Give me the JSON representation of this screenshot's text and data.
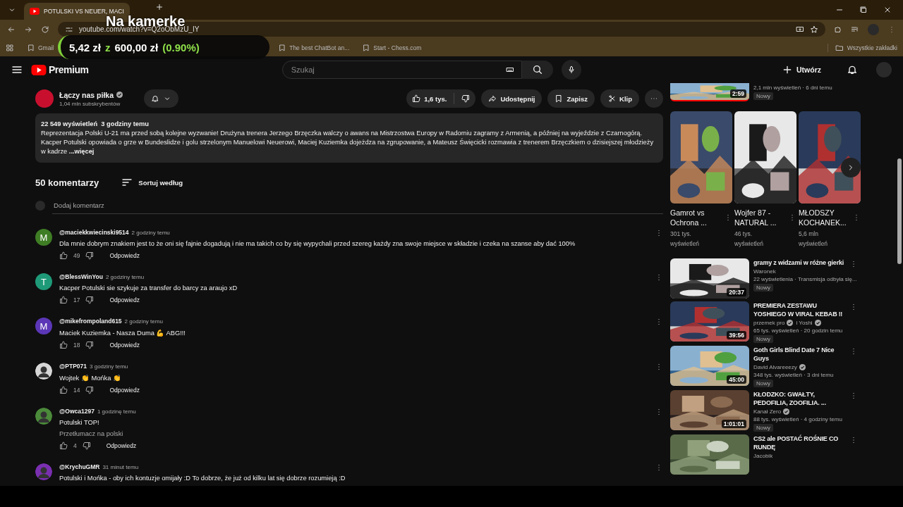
{
  "browser": {
    "tabs": [
      {
        "title": "POTULSKI VS NEUER, MACI",
        "selected": true
      }
    ],
    "url": "youtube.com/watch?v=Q2oObMzU_IY",
    "bookmarks": [
      {
        "label": "Gmail"
      },
      {
        "label": "The best ChatBot an..."
      },
      {
        "label": "Start - Chess.com"
      }
    ],
    "all_bookmarks": "Wszystkie zakładki"
  },
  "overlay": {
    "title": "Na kamerke",
    "current": "5,42 zł",
    "joiner": "z",
    "target": "600,00 zł",
    "percent": "(0.90%)"
  },
  "header": {
    "logo": "Premium",
    "search_placeholder": "Szukaj",
    "create": "Utwórz"
  },
  "channel": {
    "name": "Łączy nas piłka",
    "subscribers": "1,04 mln subskrybentów",
    "likes": "1,6 tys.",
    "share": "Udostępnij",
    "save": "Zapisz",
    "clip": "Klip"
  },
  "description": {
    "stats": "22 549 wyświetleń  3 godziny temu",
    "text": "Reprezentacja Polski U-21 ma przed sobą kolejne wyzwanie! Drużyna trenera Jerzego Brzęczka walczy o awans na Mistrzostwa Europy w Radomiu zagramy z Armenią, a później na wyjeździe z Czarnogórą. Kacper Potulski opowiada o grze w Bundeslidze i golu strzelonym Manuelowi Neuerowi, Maciej Kuziemka dojeżdza na zgrupowanie, a Mateusz Święcicki rozmawia z trenerem Brzęczkiem o dzisiejszej młodzieży w kadrze",
    "more": "...więcej"
  },
  "comments": {
    "count": "50 komentarzy",
    "sort": "Sortuj według",
    "placeholder": "Dodaj komentarz",
    "items": [
      {
        "author": "@maciekkwiecinski9514",
        "time": "2 godziny temu",
        "text": "Dla mnie dobrym znakiem jest to że oni się fajnie dogadują i nie ma takich co by się wypychali przed szereg każdy zna swoje miejsce w składzie i czeka na szanse aby dać 100%",
        "likes": "49",
        "reply": "Odpowiedz",
        "avatar": {
          "kind": "letter",
          "letter": "M",
          "color": "#3f7d25"
        }
      },
      {
        "author": "@BlessWinYou",
        "time": "2 godziny temu",
        "text": "Kacper Potulski sie szykuje za transfer do barcy za araujo xD",
        "likes": "17",
        "reply": "Odpowiedz",
        "avatar": {
          "kind": "letter",
          "letter": "T",
          "color": "#1f9a78"
        }
      },
      {
        "author": "@mikefrompoland615",
        "time": "2 godziny temu",
        "text": "Maciek Kuziemka - Nasza Duma 💪 ABG!!!",
        "likes": "18",
        "reply": "Odpowiedz",
        "avatar": {
          "kind": "letter",
          "letter": "M",
          "color": "#5b37b7"
        }
      },
      {
        "author": "@PTP071",
        "time": "3 godziny temu",
        "text": "Wojtek 👏 Mońka 👏",
        "likes": "14",
        "reply": "Odpowiedz"
      },
      {
        "author": "@Owca1297",
        "time": "1 godzinę temu",
        "text": "Potulski TOP!",
        "translate": "Przetłumacz na polski",
        "likes": "4",
        "reply": "Odpowiedz"
      },
      {
        "author": "@KrychuGMR",
        "time": "31 minut temu",
        "text": "Potulski i Mońka - oby ich kontuzje omijały :D To dobrze, że już od kilku lat się dobrze rozumieją :D"
      }
    ]
  },
  "sidebar": {
    "partial": {
      "meta": "2,1 mln wyświetleń · 6 dni temu",
      "badge": "Nowy",
      "duration": "2:59"
    },
    "shorts": [
      {
        "title": "Gamrot vs Ochrona ...",
        "views": "301 tys. wyświetleń"
      },
      {
        "title": "Wojfer 87 - NATURAL ...",
        "views": "46 tys. wyświetleń"
      },
      {
        "title": "MŁODSZY KOCHANEK...",
        "views": "5,6 mln wyświetleń"
      }
    ],
    "videos": [
      {
        "title": "gramy z widzami w różne gierki",
        "channels": [
          {
            "name": "Waronek",
            "verified": false
          }
        ],
        "meta": "22 wyświetlenia · Transmisja odbyła się...",
        "badge": "Nowy",
        "duration": "20:37"
      },
      {
        "title": "PREMIERA ZESTAWU YOSHIEGO W VIRAL KEBAB ‼",
        "channels": [
          {
            "name": "przemek pro",
            "verified": true
          },
          {
            "name": "i Yoshi",
            "verified": true
          }
        ],
        "meta": "65 tys. wyświetleń · 20 godzin temu",
        "badge": "Nowy",
        "duration": "39:56"
      },
      {
        "title": "Goth Girls Blind Date 7 Nice Guys",
        "channels": [
          {
            "name": "David Alvareeezy",
            "verified": true
          }
        ],
        "meta": "348 tys. wyświetleń · 3 dni temu",
        "badge": "Nowy",
        "duration": "45:00"
      },
      {
        "title": "KŁODZKO: GWAŁTY, PEDOFILIA, ZOOFILIA. ...",
        "channels": [
          {
            "name": "Kanał Zero",
            "verified": true
          }
        ],
        "meta": "88 tys. wyświetleń · 4 godziny temu",
        "badge": "Nowy",
        "duration": "1:01:01"
      },
      {
        "title": "CS2 ale POSTAĆ ROŚNIE CO RUNDĘ",
        "channels": [
          {
            "name": "Jacobik",
            "verified": false
          }
        ]
      }
    ]
  }
}
